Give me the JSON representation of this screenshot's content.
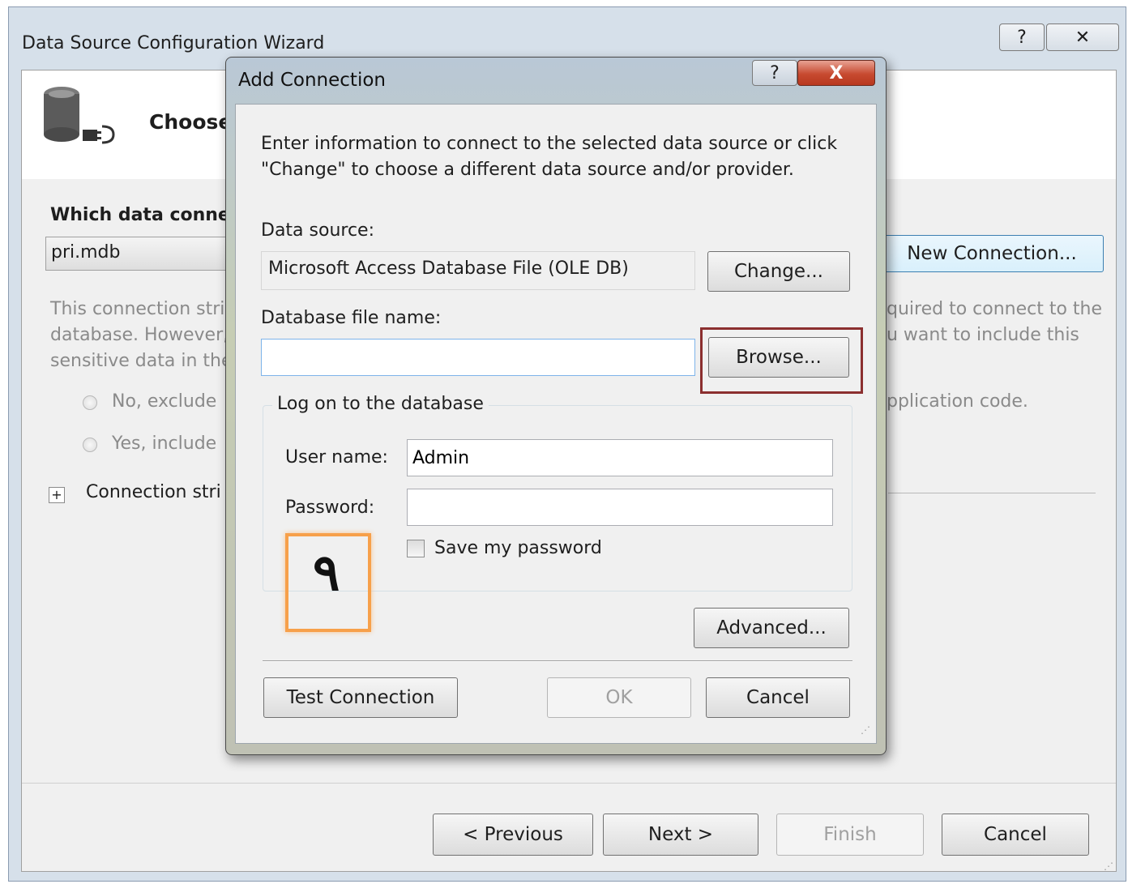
{
  "wizard": {
    "title": "Data Source Configuration Wizard",
    "help_glyph": "?",
    "close_glyph": "✕",
    "header_text": "Choose",
    "which_label": "Which data connec",
    "connection_value": "pri.mdb",
    "new_connection_label": "New Connection...",
    "info_left": [
      "This connection stri",
      "database. However,",
      "sensitive data in the"
    ],
    "info_right": [
      "quired to connect to the",
      "u want to include this"
    ],
    "radio_no": "No, exclude",
    "radio_yes": "Yes, include",
    "radio_right": "pplication code.",
    "expander_glyph": "+",
    "connection_string_label": "Connection stri",
    "previous_label": "< Previous",
    "next_label": "Next >",
    "finish_label": "Finish",
    "cancel_label": "Cancel"
  },
  "dialog": {
    "title": "Add Connection",
    "help_glyph": "?",
    "close_glyph": "X",
    "intro_line1": "Enter information to connect to the selected data source or click",
    "intro_line2": "\"Change\" to choose a different data source and/or provider.",
    "data_source_label": "Data source:",
    "data_source_value": "Microsoft Access Database File (OLE DB)",
    "change_label": "Change...",
    "db_file_label": "Database file name:",
    "db_file_value": "",
    "browse_label": "Browse...",
    "logon_group_label": "Log on to the database",
    "user_name_label": "User name:",
    "user_name_value": "Admin",
    "password_label": "Password:",
    "password_value": "",
    "save_password_label": "Save my password",
    "advanced_label": "Advanced...",
    "test_connection_label": "Test Connection",
    "ok_label": "OK",
    "cancel_label": "Cancel"
  },
  "annotation": {
    "step_marker": "٩",
    "highlight_browse_color": "#8b2f2f",
    "highlight_step_color": "#f7a04a"
  }
}
